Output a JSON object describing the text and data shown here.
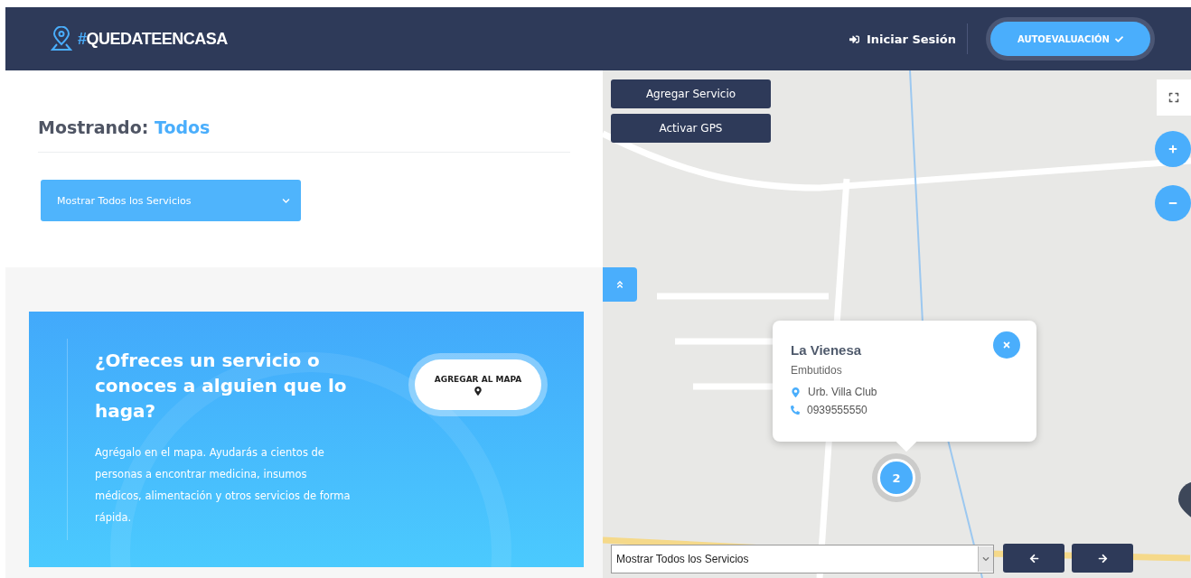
{
  "header": {
    "logo": {
      "prefix": "#",
      "text": "QUEDATEENCASA"
    },
    "login": "Iniciar Sesión",
    "cta": "AUTOEVALUACIÓN"
  },
  "filter": {
    "label": "Mostrando:",
    "value": "Todos",
    "select": "Mostrar Todos los Servicios"
  },
  "promo": {
    "title": "¿Ofreces un servicio o conoces a alguien que lo haga?",
    "body": "Agrégalo en el mapa. Ayudarás a cientos de personas a encontrar medicina, insumos médicos, alimentación y otros servicios de forma rápida.",
    "button": "AGREGAR AL MAPA"
  },
  "map": {
    "buttons": [
      "Agregar Servicio",
      "Activar GPS"
    ],
    "popup": {
      "title": "La Vienesa",
      "category": "Embutidos",
      "address": "Urb. Villa Club",
      "phone": "0939555550"
    },
    "cluster": "2",
    "select": "Mostrar Todos los Servicios"
  }
}
